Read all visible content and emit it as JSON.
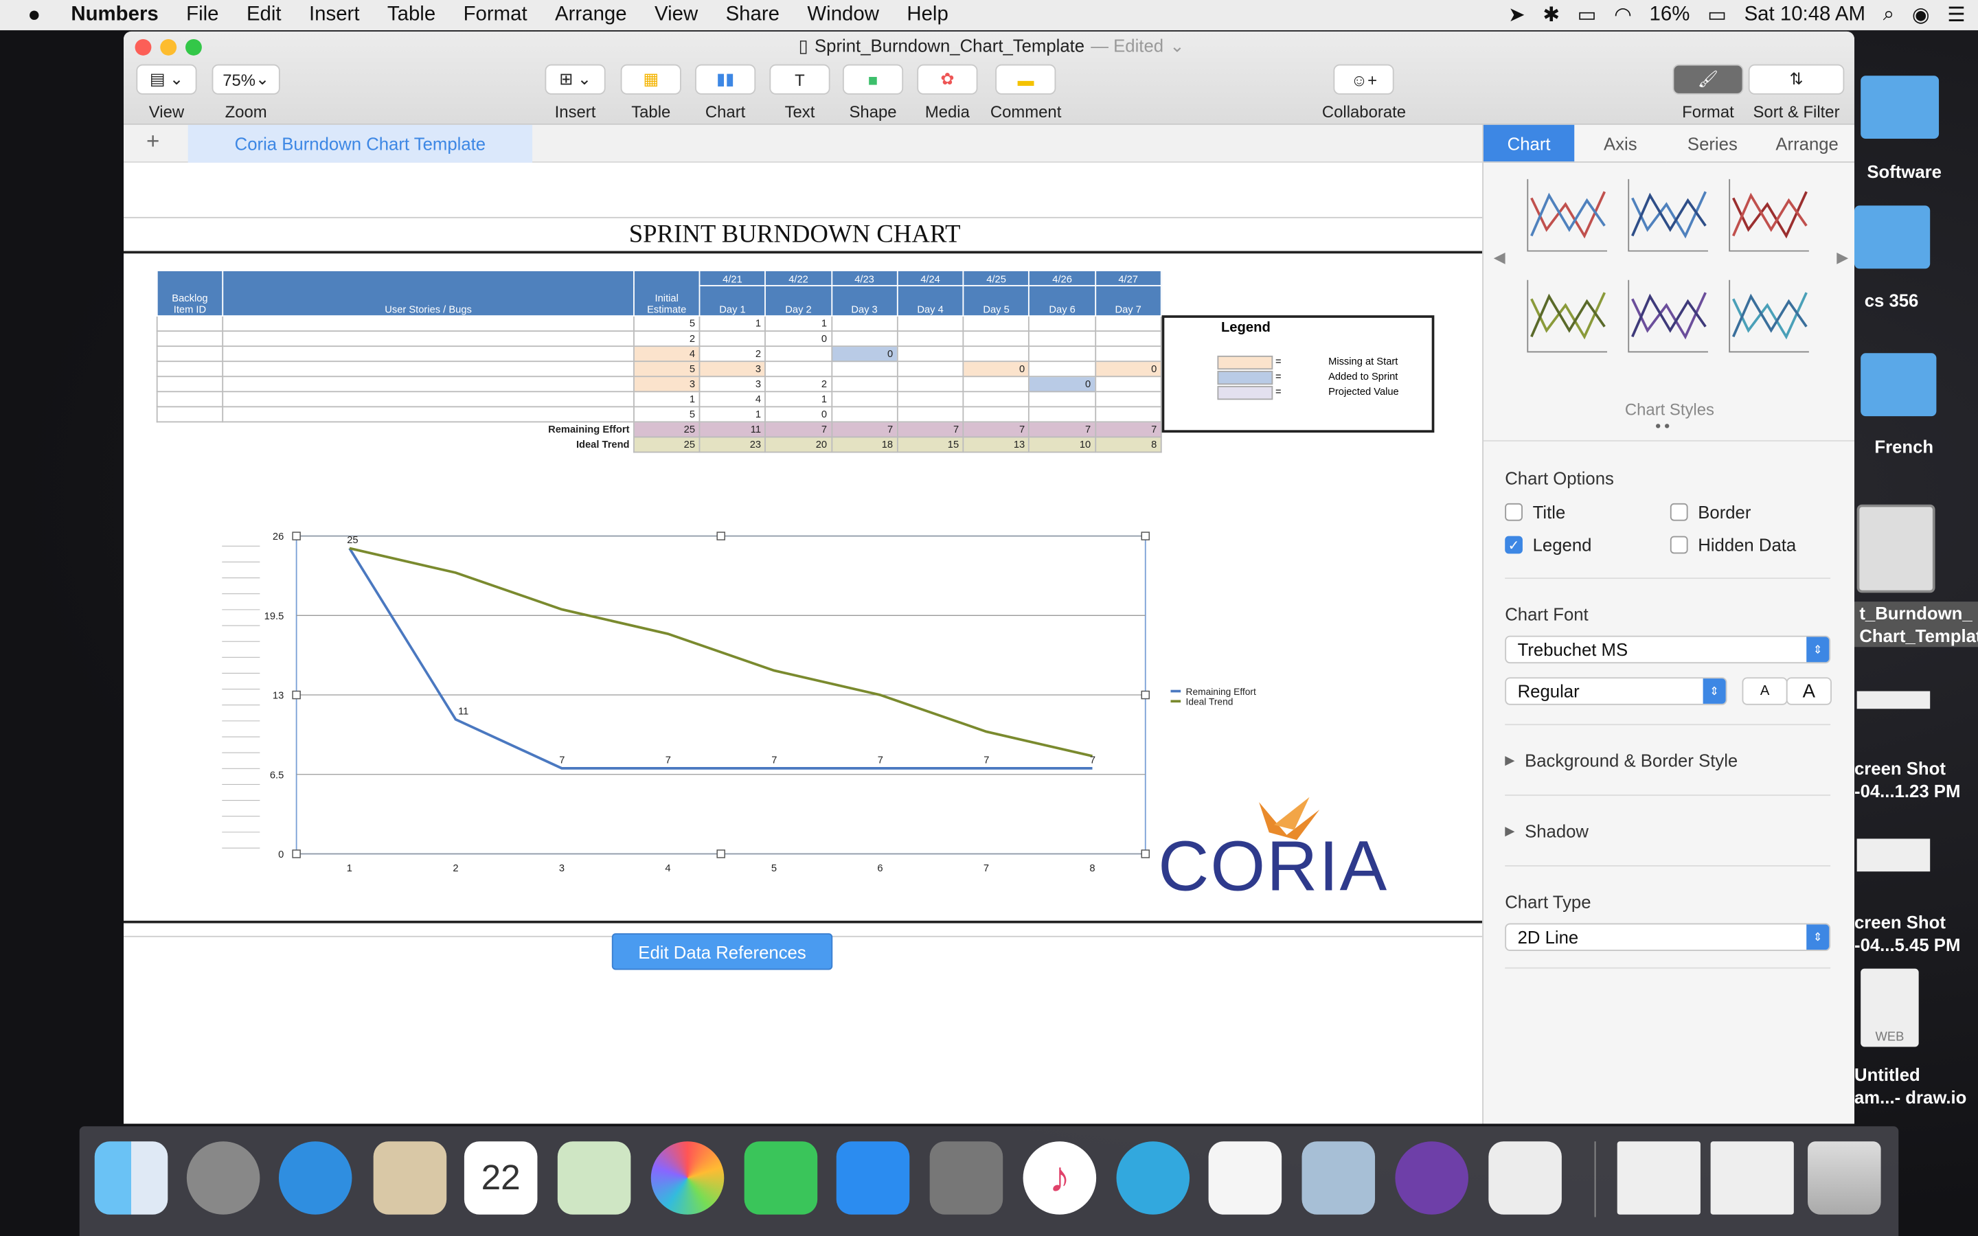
{
  "menubar": {
    "app": "Numbers",
    "items": [
      "File",
      "Edit",
      "Insert",
      "Table",
      "Format",
      "Arrange",
      "View",
      "Share",
      "Window",
      "Help"
    ],
    "battery": "16%",
    "clock": "Sat 10:48 AM"
  },
  "window": {
    "title": "Sprint_Burndown_Chart_Template",
    "status": "— Edited"
  },
  "toolbar": {
    "view": "View",
    "zoom_value": "75%",
    "zoom": "Zoom",
    "insert": "Insert",
    "table": "Table",
    "chart": "Chart",
    "text": "Text",
    "shape": "Shape",
    "media": "Media",
    "comment": "Comment",
    "collaborate": "Collaborate",
    "format": "Format",
    "sort_filter": "Sort & Filter"
  },
  "sheet": {
    "add": "+",
    "tab": "Coria Burndown Chart Template",
    "title": "SPRINT BURNDOWN CHART",
    "edit_refs": "Edit Data References"
  },
  "table": {
    "col_id": "Backlog Item ID",
    "col_story": "User Stories / Bugs",
    "col_init": "Initial Estimate",
    "dates": [
      "4/21",
      "4/22",
      "4/23",
      "4/24",
      "4/25",
      "4/26",
      "4/27"
    ],
    "days": [
      "Day 1",
      "Day 2",
      "Day 3",
      "Day 4",
      "Day 5",
      "Day 6",
      "Day 7"
    ],
    "rows": [
      [
        "5",
        "1",
        "1",
        "",
        "",
        "",
        "",
        ""
      ],
      [
        "2",
        "",
        "0",
        "",
        "",
        "",
        "",
        ""
      ],
      [
        "4",
        "2",
        "",
        "0",
        "",
        "",
        "",
        ""
      ],
      [
        "5",
        "3",
        "",
        "",
        "",
        "0",
        "",
        "0"
      ],
      [
        "3",
        "3",
        "2",
        "",
        "",
        "",
        "0",
        ""
      ],
      [
        "1",
        "4",
        "1",
        "",
        "",
        "",
        "",
        ""
      ],
      [
        "5",
        "1",
        "0",
        "",
        "",
        "",
        "",
        ""
      ]
    ],
    "remaining_label": "Remaining Effort",
    "remaining": [
      "25",
      "11",
      "7",
      "7",
      "7",
      "7",
      "7",
      "7"
    ],
    "ideal_label": "Ideal Trend",
    "ideal": [
      "25",
      "23",
      "20",
      "18",
      "15",
      "13",
      "10",
      "8"
    ]
  },
  "legend_box": {
    "title": "Legend",
    "items": [
      "Missing at Start",
      "Added to Sprint",
      "Projected Value"
    ],
    "eq": "="
  },
  "chart_data": {
    "type": "line",
    "x": [
      1,
      2,
      3,
      4,
      5,
      6,
      7,
      8
    ],
    "yticks": [
      "0",
      "6.5",
      "13",
      "19.5",
      "26"
    ],
    "ylim": [
      0,
      26
    ],
    "series": [
      {
        "name": "Remaining Effort",
        "color": "#4a78c0",
        "values": [
          25,
          11,
          7,
          7,
          7,
          7,
          7,
          7
        ]
      },
      {
        "name": "Ideal Trend",
        "color": "#7a8a2e",
        "values": [
          25,
          23,
          20,
          18,
          15,
          13,
          10,
          8
        ]
      }
    ],
    "labels": [
      "25",
      "11",
      "7",
      "7",
      "7",
      "7",
      "7",
      "7"
    ],
    "legend_position": "right",
    "grid": true
  },
  "logo": {
    "text": "CORIA"
  },
  "sidebar": {
    "tabs": [
      "Chart",
      "Axis",
      "Series",
      "Arrange"
    ],
    "styles_label": "Chart Styles",
    "options_title": "Chart Options",
    "opt_title": "Title",
    "opt_border": "Border",
    "opt_legend": "Legend",
    "opt_hidden": "Hidden Data",
    "font_title": "Chart Font",
    "font": "Trebuchet MS",
    "font_style": "Regular",
    "font_small": "A",
    "font_big": "A",
    "bg_border": "Background & Border Style",
    "shadow": "Shadow",
    "type_title": "Chart Type",
    "type": "2D Line"
  },
  "desktop": {
    "items": [
      "Software",
      "cs 356",
      "French",
      "t_Burndown_\nChart_Template",
      "creen Shot\n-04...1.23 PM",
      "creen Shot\n-04...5.45 PM",
      "Untitled\nam...- draw.io"
    ],
    "web": "WEB"
  }
}
